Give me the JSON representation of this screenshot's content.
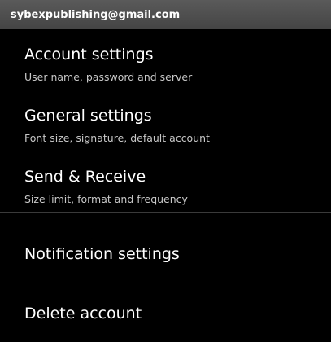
{
  "header": {
    "account_email": "sybexpublishing@gmail.com"
  },
  "menu": {
    "items": [
      {
        "title": "Account settings",
        "subtitle": "User name, password and server"
      },
      {
        "title": "General settings",
        "subtitle": "Font size, signature, default account"
      },
      {
        "title": "Send & Receive",
        "subtitle": "Size limit, format and frequency"
      },
      {
        "title": "Notification settings"
      },
      {
        "title": "Delete account"
      }
    ]
  },
  "colors": {
    "background": "#000000",
    "header_background": "#4e4e4e",
    "divider": "#3a3a3a",
    "title_text": "#ffffff",
    "subtitle_text": "#c8c8c8"
  }
}
